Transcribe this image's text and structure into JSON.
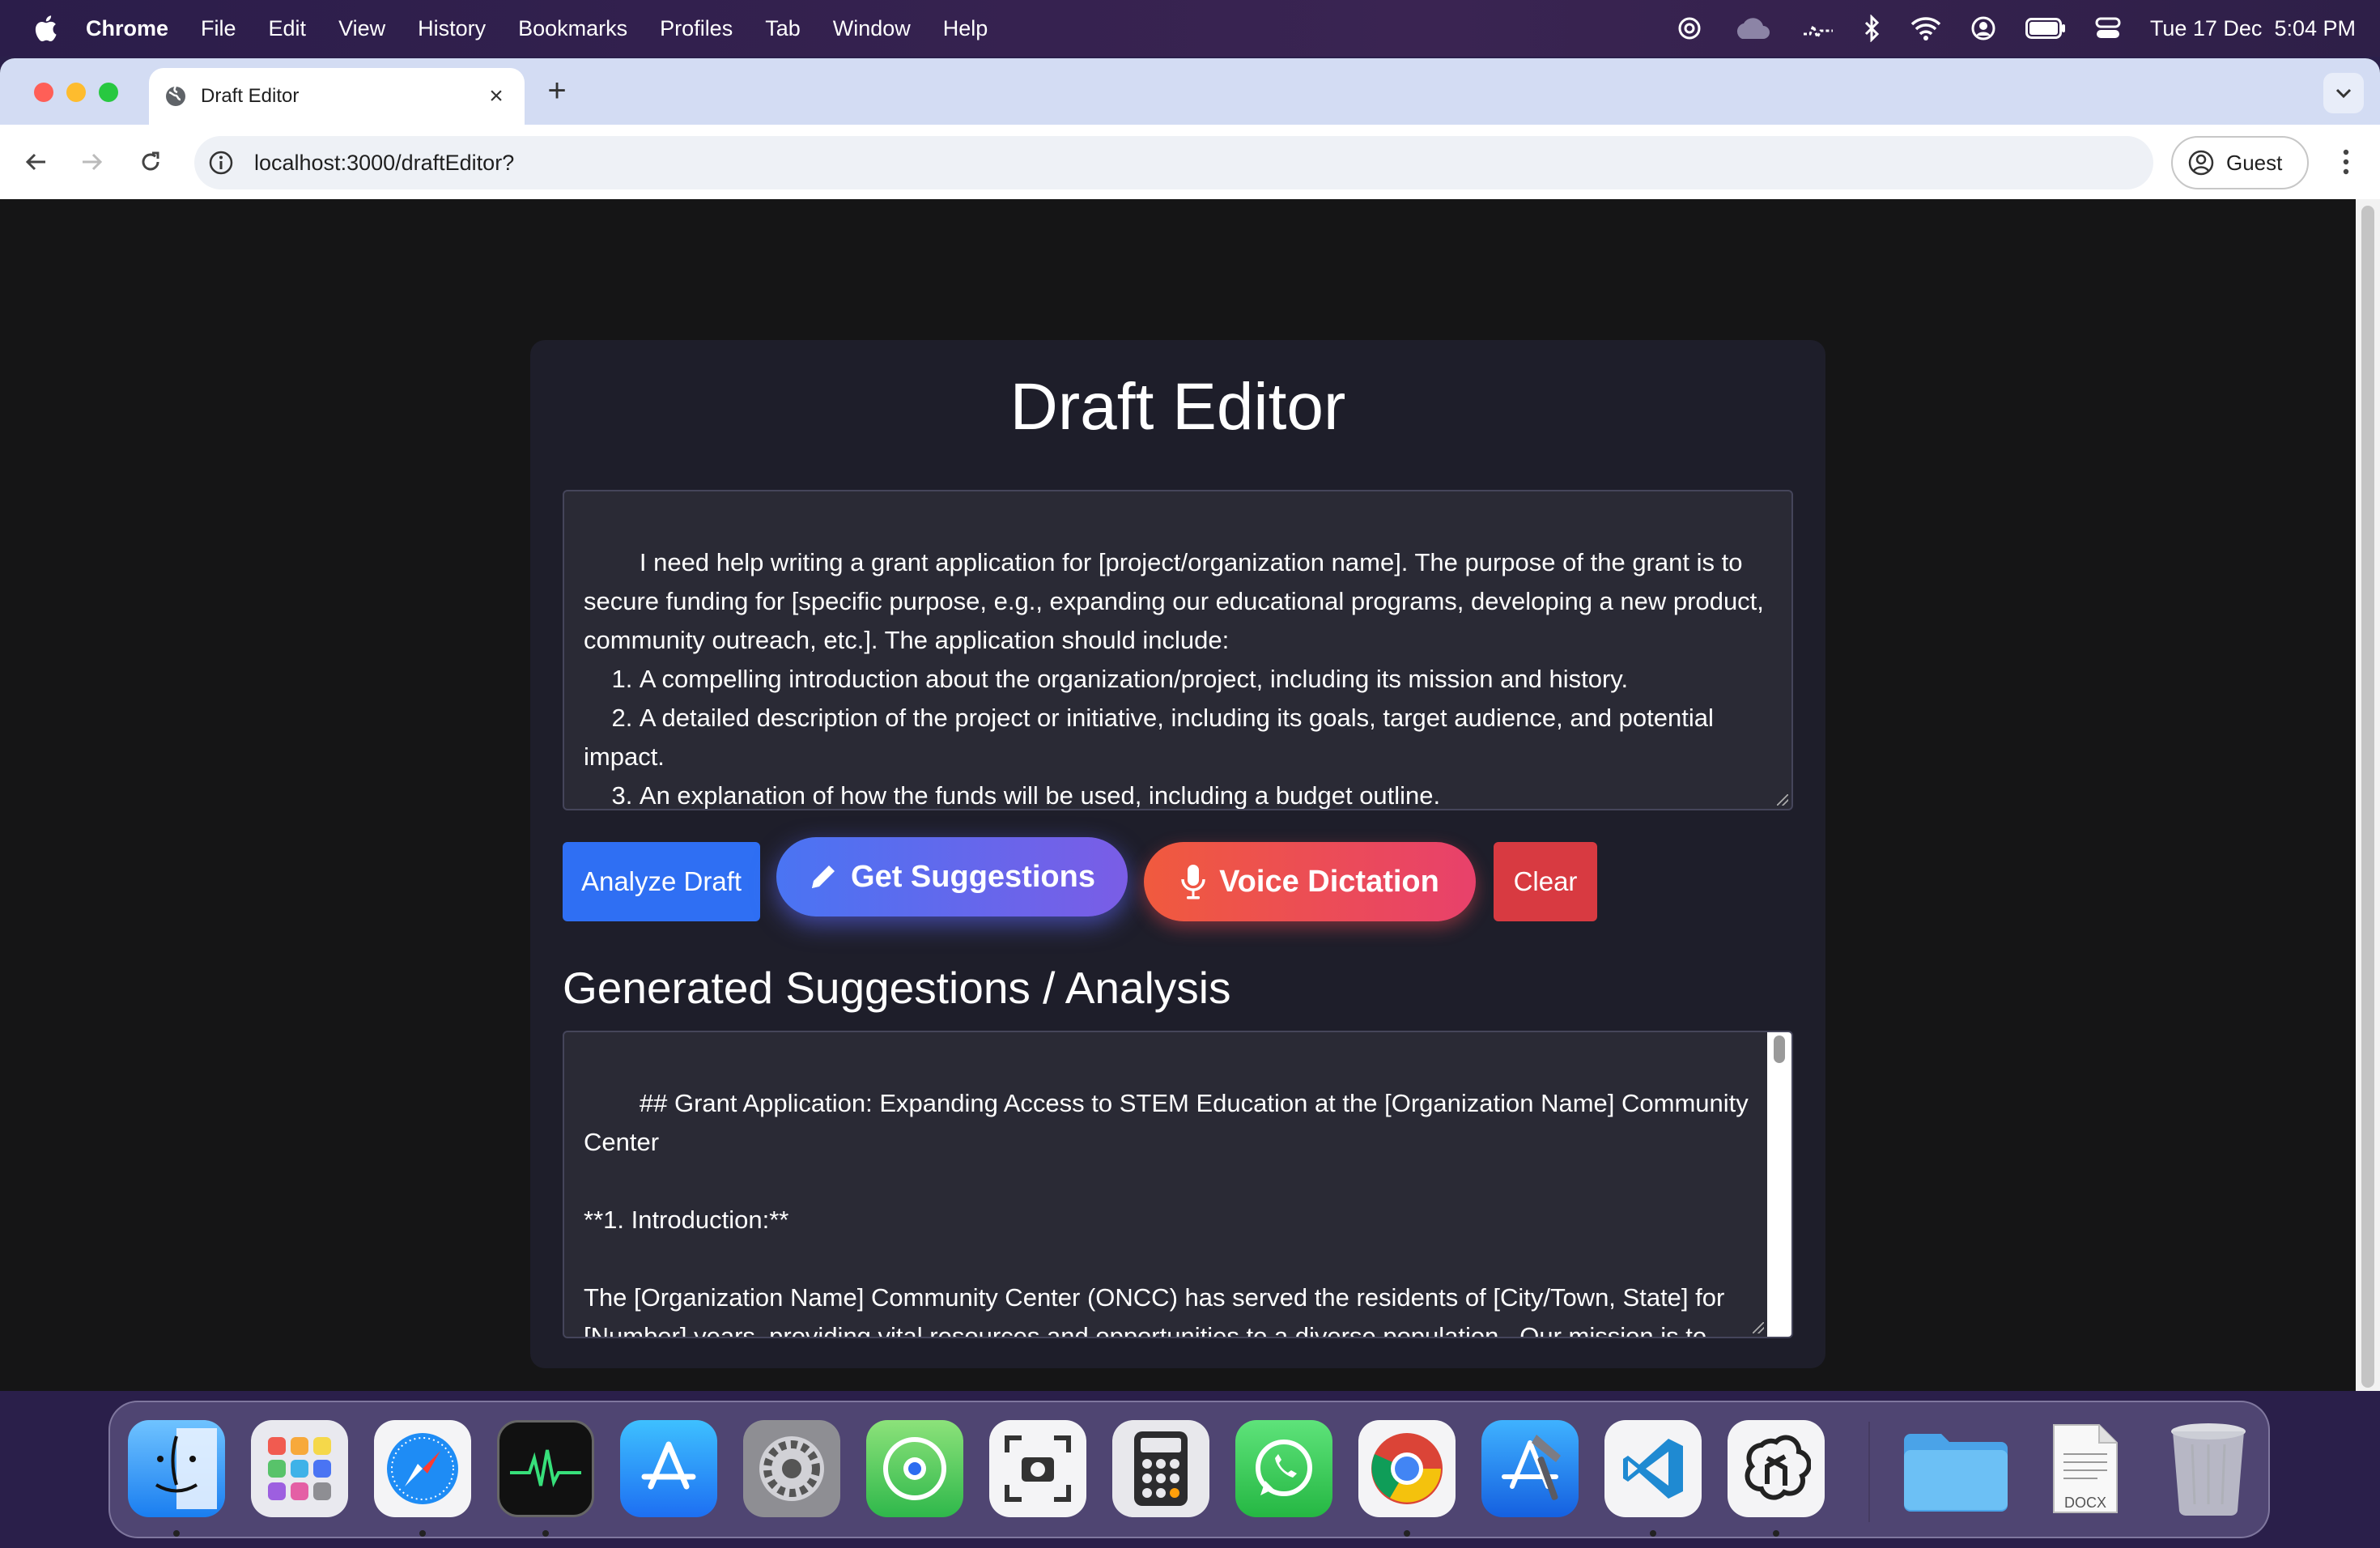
{
  "menubar": {
    "app": "Chrome",
    "items": [
      "File",
      "Edit",
      "View",
      "History",
      "Bookmarks",
      "Profiles",
      "Tab",
      "Window",
      "Help"
    ],
    "date": "Tue 17 Dec",
    "time": "5:04 PM"
  },
  "browser": {
    "tab_title": "Draft Editor",
    "url": "localhost:3000/draftEditor?",
    "profile_label": "Guest"
  },
  "page": {
    "title": "Draft Editor",
    "draft_text": "I need help writing a grant application for [project/organization name]. The purpose of the grant is to secure funding for [specific purpose, e.g., expanding our educational programs, developing a new product, community outreach, etc.]. The application should include:\n\t1.\tA compelling introduction about the organization/project, including its mission and history.\n\t2.\tA detailed description of the project or initiative, including its goals, target audience, and potential impact.\n\t3.\tAn explanation of how the funds will be used, including a budget outline.",
    "buttons": {
      "analyze": "Analyze Draft",
      "suggest": "Get Suggestions",
      "voice": "Voice Dictation",
      "clear": "Clear"
    },
    "results_heading": "Generated Suggestions / Analysis",
    "results_text": "## Grant Application: Expanding Access to STEM Education at the [Organization Name] Community Center\n\n**1. Introduction:**\n\nThe [Organization Name] Community Center (ONCC) has served the residents of [City/Town, State] for [Number] years, providing vital resources and opportunities to a diverse population.  Our mission is to foster community growth and empowerment through accessible and enriching programs."
  },
  "dock": {
    "apps": [
      "Finder",
      "Launchpad",
      "Safari",
      "Activity Monitor",
      "App Store",
      "System Settings",
      "Find My",
      "Screenshot",
      "Calculator",
      "WhatsApp",
      "Chrome",
      "Xcode",
      "Visual Studio Code",
      "ChatGPT",
      "Downloads Folder",
      "DOCX",
      "Trash"
    ],
    "docx_label": "DOCX"
  }
}
